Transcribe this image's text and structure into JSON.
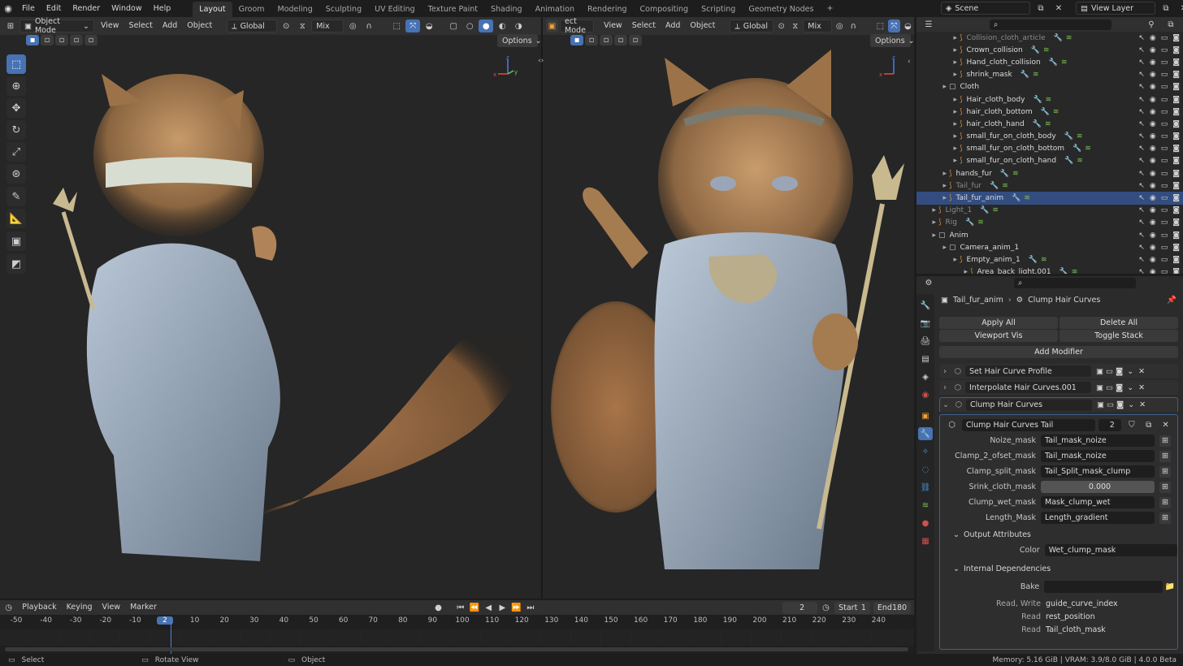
{
  "menu": [
    "File",
    "Edit",
    "Render",
    "Window",
    "Help"
  ],
  "workspaces": [
    "Layout",
    "Groom",
    "Modeling",
    "Sculpting",
    "UV Editing",
    "Texture Paint",
    "Shading",
    "Animation",
    "Rendering",
    "Compositing",
    "Scripting",
    "Geometry Nodes"
  ],
  "scene": {
    "name": "Scene",
    "view_layer": "View Layer"
  },
  "vp_left": {
    "mode": "Object Mode",
    "menus": [
      "View",
      "Select",
      "Add",
      "Object"
    ],
    "transform": "Global",
    "mix": "Mix",
    "options": "Options"
  },
  "vp_right": {
    "mode": "ect Mode",
    "menus": [
      "View",
      "Select",
      "Add",
      "Object"
    ],
    "transform": "Global",
    "mix": "Mix",
    "options": "Options"
  },
  "outliner": {
    "rows": [
      {
        "name": "Collision_cloth_article",
        "indent": 3,
        "dim": true
      },
      {
        "name": "Crown_collision",
        "indent": 3
      },
      {
        "name": "Hand_cloth_collision",
        "indent": 3
      },
      {
        "name": "shrink_mask",
        "indent": 3
      },
      {
        "name": "Cloth",
        "indent": 2,
        "collection": true
      },
      {
        "name": "Hair_cloth_body",
        "indent": 3
      },
      {
        "name": "hair_cloth_bottom",
        "indent": 3
      },
      {
        "name": "hair_cloth_hand",
        "indent": 3
      },
      {
        "name": "small_fur_on_cloth_body",
        "indent": 3
      },
      {
        "name": "small_fur_on_cloth_bottom",
        "indent": 3
      },
      {
        "name": "small_fur_on_cloth_hand",
        "indent": 3
      },
      {
        "name": "hands_fur",
        "indent": 2
      },
      {
        "name": "Tail_fur",
        "indent": 2,
        "dim": true
      },
      {
        "name": "Tail_fur_anim",
        "indent": 2,
        "selected": true
      },
      {
        "name": "Light_1",
        "indent": 1,
        "dim": true
      },
      {
        "name": "Rig",
        "indent": 1,
        "dim": true
      },
      {
        "name": "Anim",
        "indent": 1,
        "collection": true
      },
      {
        "name": "Camera_anim_1",
        "indent": 2,
        "collection": true
      },
      {
        "name": "Empty_anim_1",
        "indent": 3
      },
      {
        "name": "Area_back_light.001",
        "indent": 4
      }
    ]
  },
  "props": {
    "object": "Tail_fur_anim",
    "modifier": "Clump Hair Curves",
    "apply_all": "Apply All",
    "delete_all": "Delete All",
    "viewport_vis": "Viewport Vis",
    "toggle_stack": "Toggle Stack",
    "add_modifier": "Add Modifier",
    "modifiers": [
      "Set Hair Curve Profile",
      "Interpolate Hair Curves.001",
      "Clump Hair Curves"
    ],
    "node_group": "Clump Hair Curves Tail",
    "node_users": "2",
    "inputs": [
      {
        "label": "Noize_mask",
        "value": "Tail_mask_noize"
      },
      {
        "label": "Clamp_2_ofset_mask",
        "value": "Tail_mask_noize"
      },
      {
        "label": "Clamp_split_mask",
        "value": "Tail_Split_mask_clump"
      },
      {
        "label": "Srink_cloth_mask",
        "value": "0.000",
        "numeric": true
      },
      {
        "label": "Clump_wet_mask",
        "value": "Mask_clump_wet"
      },
      {
        "label": "Length_Mask",
        "value": "Length_gradient"
      }
    ],
    "output_section": "Output Attributes",
    "color_label": "Color",
    "color_value": "Wet_clump_mask",
    "internal_section": "Internal Dependencies",
    "bake_label": "Bake",
    "deps": [
      {
        "label": "Read, Write",
        "value": "guide_curve_index"
      },
      {
        "label": "Read",
        "value": "rest_position"
      },
      {
        "label": "Read",
        "value": "Tail_cloth_mask"
      }
    ]
  },
  "timeline": {
    "menus": [
      "Playback",
      "Keying",
      "View",
      "Marker"
    ],
    "current_frame": "2",
    "start_label": "Start",
    "start": "1",
    "end_label": "End",
    "end": "180",
    "ticks": [
      "-50",
      "-40",
      "-30",
      "-20",
      "-10",
      "2",
      "10",
      "20",
      "30",
      "40",
      "50",
      "60",
      "70",
      "80",
      "90",
      "100",
      "110",
      "120",
      "130",
      "140",
      "150",
      "160",
      "170",
      "180",
      "190",
      "200",
      "210",
      "220",
      "230",
      "240"
    ]
  },
  "status": {
    "select": "Select",
    "rotate": "Rotate View",
    "object": "Object",
    "info": "Memory: 5.16 GiB | VRAM: 3.9/8.0 GiB | 4.0.0 Beta"
  }
}
